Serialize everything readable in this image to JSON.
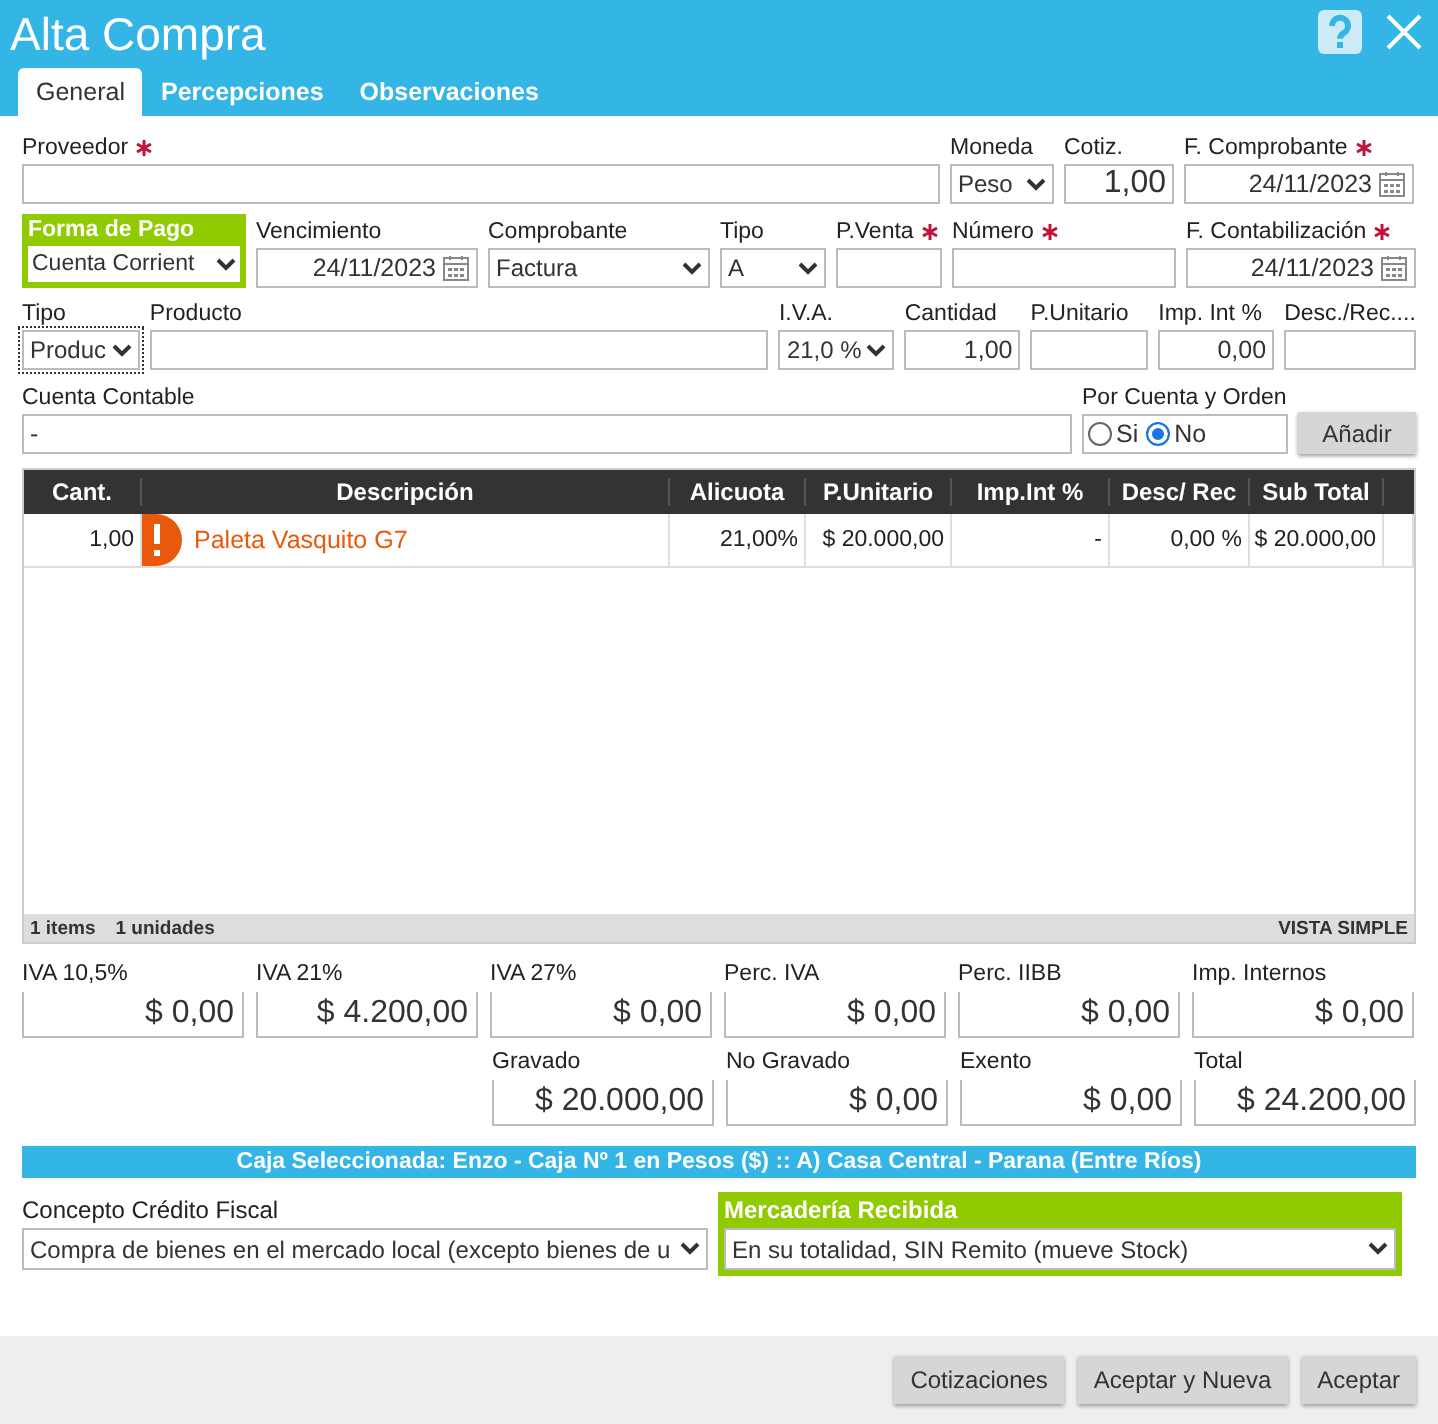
{
  "window": {
    "title": "Alta Compra"
  },
  "tabs": [
    {
      "label": "General",
      "selected": true
    },
    {
      "label": "Percepciones",
      "selected": false
    },
    {
      "label": "Observaciones",
      "selected": false
    }
  ],
  "form_rows": [
    [
      {
        "kind": "text",
        "label": "Proveedor",
        "required": true
      },
      {
        "kind": "select",
        "label": "Moneda",
        "value": "Peso"
      },
      {
        "kind": "number",
        "label": "Cotiz.",
        "value": "1,00"
      },
      {
        "kind": "date",
        "label": "F. Comprobante",
        "required": true,
        "value": "24/11/2023"
      }
    ],
    [
      {
        "kind": "select",
        "label": "Forma de Pago",
        "highlight": true,
        "value": "Cuenta Corrient"
      },
      {
        "kind": "date",
        "label": "Vencimiento",
        "value": "24/11/2023"
      },
      {
        "kind": "select",
        "label": "Comprobante",
        "value": "Factura"
      },
      {
        "kind": "select",
        "label": "Tipo",
        "value": "A"
      },
      {
        "kind": "text",
        "label": "P.Venta",
        "required": true
      },
      {
        "kind": "text",
        "label": "Número",
        "required": true
      },
      {
        "kind": "date",
        "label": "F. Contabilización",
        "required": true,
        "value": "24/11/2023"
      }
    ],
    [
      {
        "kind": "select",
        "label": "Tipo",
        "value": "Produc",
        "focused": true
      },
      {
        "kind": "text",
        "label": "Producto"
      },
      {
        "kind": "select",
        "label": "I.V.A.",
        "value": "21,0 %"
      },
      {
        "kind": "number",
        "label": "Cantidad",
        "value": "1,00"
      },
      {
        "kind": "text",
        "label": "P.Unitario"
      },
      {
        "kind": "number",
        "label": "Imp. Int %",
        "value": "0,00"
      },
      {
        "kind": "text",
        "label": "Desc./Rec...."
      }
    ],
    [
      {
        "kind": "text",
        "label": "Cuenta Contable",
        "value": "-"
      },
      {
        "kind": "radio",
        "label": "Por Cuenta y Orden",
        "options": [
          {
            "label": "Si",
            "selected": false
          },
          {
            "label": "No",
            "selected": true
          }
        ]
      },
      {
        "kind": "button",
        "value": "Añadir"
      }
    ]
  ],
  "table": {
    "columns": [
      "Cant.",
      "Descripción",
      "Alicuota",
      "P.Unitario",
      "Imp.Int %",
      "Desc/ Rec",
      "Sub Total"
    ],
    "rows": [
      {
        "cells": [
          "1,00",
          "Paleta Vasquito G7",
          "21,00%",
          "$ 20.000,00",
          "-",
          "0,00 %",
          "$ 20.000,00"
        ],
        "warning": true
      }
    ],
    "footer": {
      "items": "1 items",
      "units": "1 unidades",
      "view": "VISTA SIMPLE"
    }
  },
  "totals": {
    "row_1": [
      {
        "label": "IVA 10,5%",
        "value": "$ 0,00"
      },
      {
        "label": "IVA 21%",
        "value": "$ 4.200,00"
      },
      {
        "label": "IVA 27%",
        "value": "$ 0,00"
      },
      {
        "label": "Perc. IVA",
        "value": "$ 0,00"
      },
      {
        "label": "Perc. IIBB",
        "value": "$ 0,00"
      },
      {
        "label": "Imp. Internos",
        "value": "$ 0,00"
      }
    ],
    "row_2": [
      {
        "label": "Gravado",
        "value": "$ 20.000,00"
      },
      {
        "label": "No Gravado",
        "value": "$ 0,00"
      },
      {
        "label": "Exento",
        "value": "$ 0,00"
      },
      {
        "label": "Total",
        "value": "$ 24.200,00"
      }
    ]
  },
  "cash_bar": "Caja Seleccionada: Enzo - Caja Nº 1 en Pesos ($) :: A) Casa Central - Parana (Entre Ríos)",
  "bottom_fields": [
    {
      "label": "Concepto Crédito Fiscal",
      "value": "Compra de bienes en el mercado local (excepto bienes de u",
      "highlight": false
    },
    {
      "label": "Mercadería Recibida",
      "value": "En su totalidad, SIN Remito (mueve Stock)",
      "highlight": true
    }
  ],
  "buttons": [
    "Cotizaciones",
    "Aceptar y Nueva",
    "Aceptar"
  ]
}
